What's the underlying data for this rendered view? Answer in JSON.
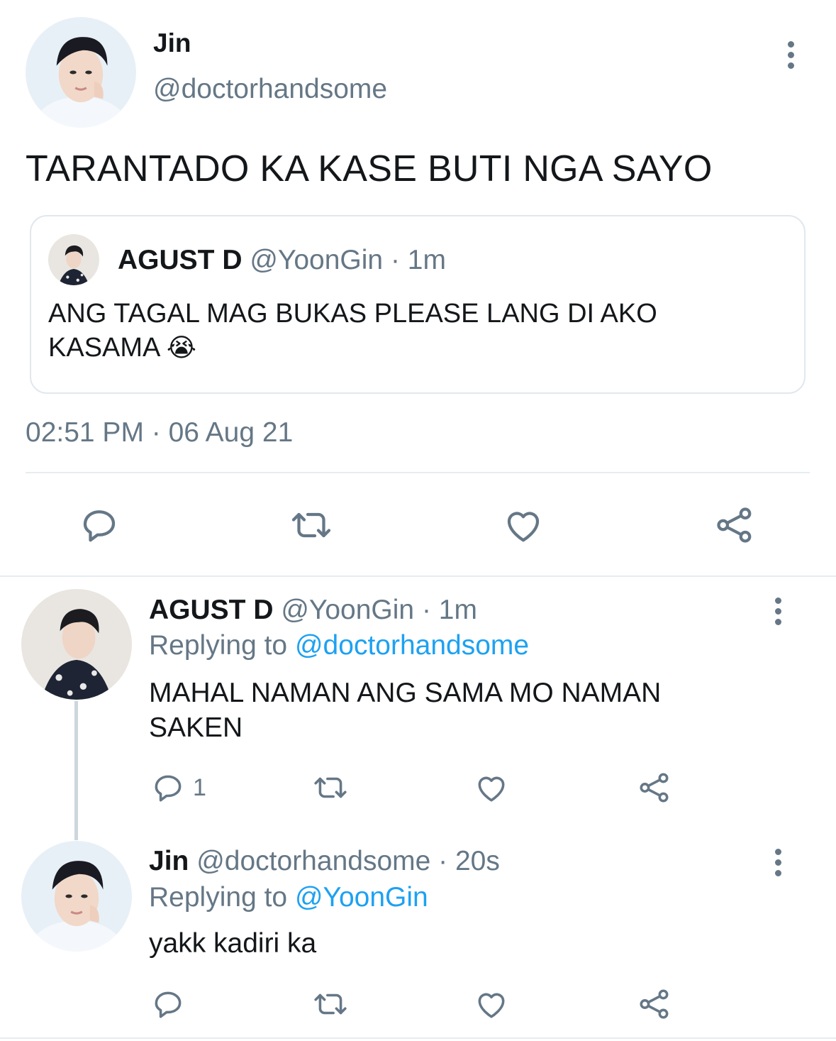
{
  "main_tweet": {
    "author_name": "Jin",
    "author_handle": "@doctorhandsome",
    "text": "TARANTADO KA KASE BUTI NGA SAYO",
    "timestamp": "02:51 PM · 06 Aug 21",
    "quote": {
      "author_name": "AGUST D",
      "author_handle": "@YoonGin",
      "time": "· 1m",
      "text_line1": "ANG TAGAL MAG BUKAS PLEASE LANG DI AKO",
      "text_line2": "KASAMA",
      "emoji": "😭"
    }
  },
  "replies": [
    {
      "author_name": "AGUST D",
      "author_handle": "@YoonGin",
      "time": "· 1m",
      "replying_label": "Replying to",
      "replying_to": "@doctorhandsome",
      "text_line1": "MAHAL NAMAN ANG SAMA MO NAMAN",
      "text_line2": "SAKEN",
      "reply_count": "1"
    },
    {
      "author_name": "Jin",
      "author_handle": "@doctorhandsome",
      "time": "· 20s",
      "replying_label": "Replying to",
      "replying_to": "@YoonGin",
      "text": "yakk kadiri ka"
    }
  ],
  "icons": [
    "reply-icon",
    "retweet-icon",
    "like-icon",
    "share-icon",
    "more-icon"
  ],
  "colors": {
    "link": "#1da1f2",
    "muted": "#657786",
    "text": "#14171a",
    "border": "#e1e8ed"
  }
}
